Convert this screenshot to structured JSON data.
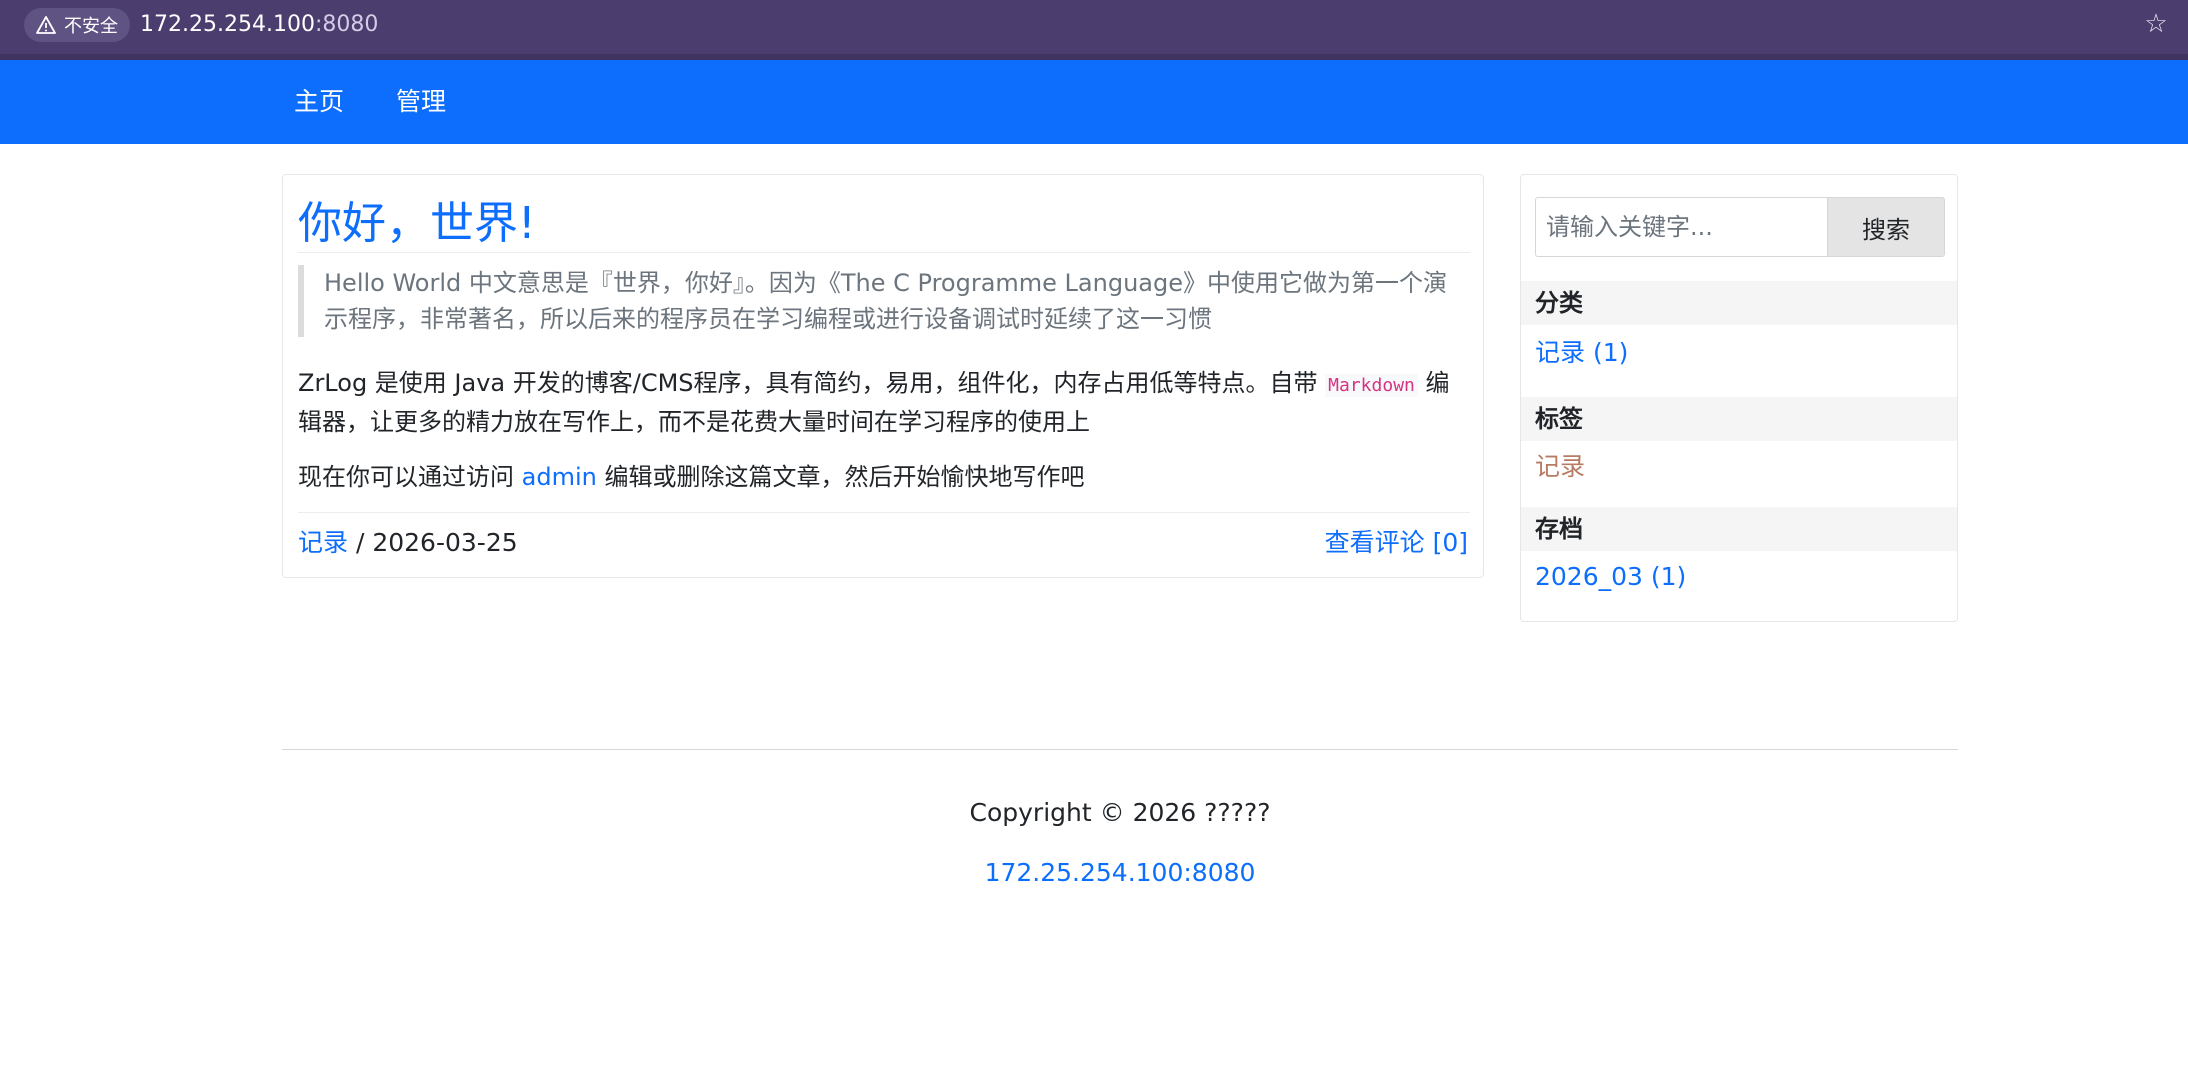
{
  "browser": {
    "security_label": "不安全",
    "url_host": "172.25.254.100",
    "url_port": ":8080",
    "bookmark_icon": "star-icon",
    "warning_icon": "warning-triangle-icon"
  },
  "navbar": {
    "items": [
      {
        "label": "主页"
      },
      {
        "label": "管理"
      }
    ],
    "color": "#0d6efd"
  },
  "post": {
    "title": "你好，世界!",
    "quote": "Hello World 中文意思是『世界，你好』。因为《The C Programme Language》中使用它做为第一个演示程序，非常著名，所以后来的程序员在学习编程或进行设备调试时延续了这一习惯",
    "para1_before": "ZrLog 是使用 Java 开发的博客/CMS程序，具有简约，易用，组件化，内存占用低等特点。自带 ",
    "para1_code": "Markdown",
    "para1_after": " 编辑器，让更多的精力放在写作上，而不是花费大量时间在学习程序的使用上",
    "para2_before": "现在你可以通过访问 ",
    "para2_link": "admin",
    "para2_after": " 编辑或删除这篇文章，然后开始愉快地写作吧",
    "category_link": "记录",
    "separator": " / ",
    "date": "2026-03-25",
    "comments_link": "查看评论 [0]"
  },
  "sidebar": {
    "search_placeholder": "请输入关键字...",
    "search_button": "搜索",
    "categories_title": "分类",
    "categories": [
      {
        "label": "记录 (1)"
      }
    ],
    "tags_title": "标签",
    "tags": [
      {
        "label": "记录"
      }
    ],
    "archives_title": "存档",
    "archives": [
      {
        "label": "2026_03 (1)"
      }
    ]
  },
  "footer": {
    "copyright": "Copyright © 2026 ?????",
    "link": "172.25.254.100:8080"
  }
}
